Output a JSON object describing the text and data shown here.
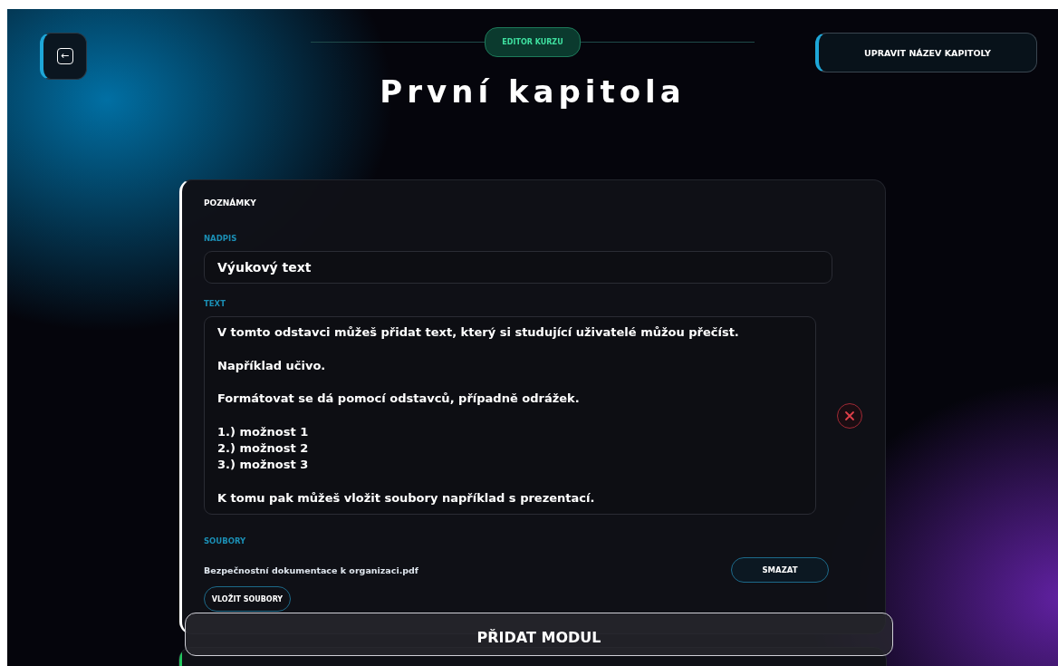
{
  "header": {
    "back_button": {
      "label": "←"
    },
    "badge": "EDITOR KURZU",
    "rename_button": "UPRAVIT NÁZEV KAPITOLY",
    "title": "První kapitola"
  },
  "modules": [
    {
      "kind": "notes",
      "color": "#ffffff",
      "heading": "POZNÁMKY",
      "title_label": "NADPIS",
      "title_value": "Výukový text",
      "text_label": "TEXT",
      "text_value": "V tomto odstavci můžeš přidat text, který si studující uživatelé můžou přečíst.\n\nNapříklad učivo.\n\nFormátovat se dá pomocí odstavců, případně odrážek.\n\n1.) možnost 1\n2.) možnost 2\n3.) možnost 3\n\nK tomu pak můžeš vložit soubory například s prezentací.",
      "files_label": "SOUBORY",
      "files": [
        {
          "name": "Bezpečnostní dokumentace k organizaci.pdf",
          "delete": "SMAZAT"
        }
      ],
      "upload": "VLOŽIT SOUBORY"
    },
    {
      "kind": "collapsed",
      "color": "#22c55e"
    }
  ],
  "add_module": "PŘIDAT MODUL"
}
